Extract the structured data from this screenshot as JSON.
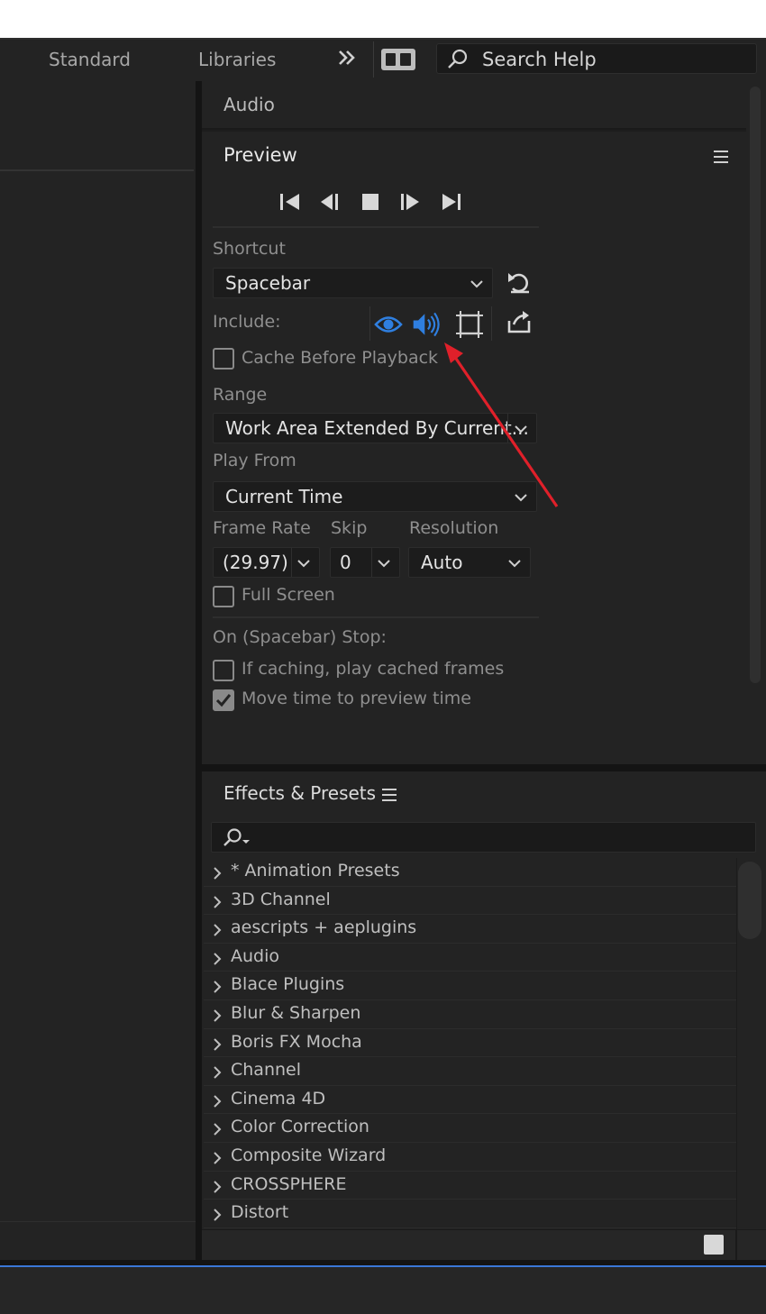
{
  "workspace": {
    "tabs": [
      "Standard",
      "Libraries"
    ],
    "search_placeholder": "Search Help"
  },
  "audio_panel": {
    "tab_label": "Audio"
  },
  "preview": {
    "title": "Preview",
    "shortcut_label": "Shortcut",
    "shortcut_value": "Spacebar",
    "include_label": "Include:",
    "cache_before_playback": "Cache Before Playback",
    "range_label": "Range",
    "range_value": "Work Area Extended By Current...",
    "play_from_label": "Play From",
    "play_from_value": "Current Time",
    "frame_rate_label": "Frame Rate",
    "frame_rate_value": "(29.97)",
    "skip_label": "Skip",
    "skip_value": "0",
    "resolution_label": "Resolution",
    "resolution_value": "Auto",
    "full_screen": "Full Screen",
    "on_stop_label": "On (Spacebar) Stop:",
    "if_caching": "If caching, play cached frames",
    "move_time": "Move time to preview time",
    "checkbox_states": {
      "cache_before_playback": false,
      "full_screen": false,
      "if_caching": false,
      "move_time": true
    },
    "include_icons": [
      "eye-icon",
      "speaker-icon",
      "overlay-icon"
    ],
    "active_include_color": "#2f7fe0"
  },
  "effects_presets": {
    "title": "Effects & Presets",
    "items": [
      "* Animation Presets",
      "3D Channel",
      "aescripts + aeplugins",
      "Audio",
      "Blace Plugins",
      "Blur & Sharpen",
      "Boris FX Mocha",
      "Channel",
      "Cinema 4D",
      "Color Correction",
      "Composite Wizard",
      "CROSSPHERE",
      "Distort"
    ]
  },
  "colors": {
    "annotation_arrow": "#e0202a",
    "accent": "#2f7fe0",
    "focus_border": "#3b78d8"
  }
}
